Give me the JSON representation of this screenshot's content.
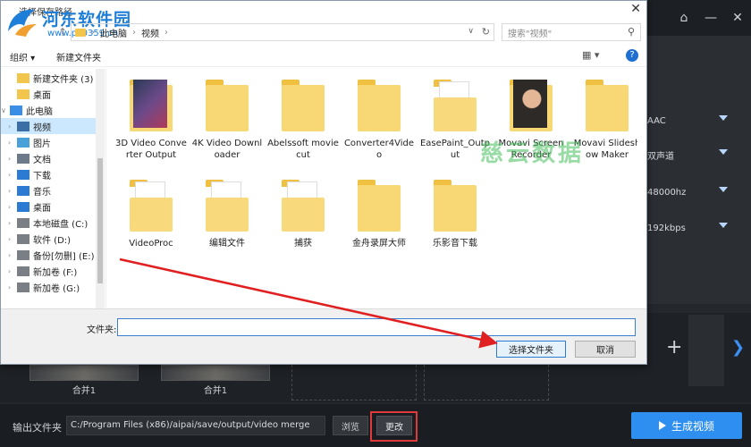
{
  "dialog": {
    "title": "选择保存路径",
    "watermark": {
      "name": "河东软件园",
      "url": "www.pc0359.cn"
    },
    "address": {
      "segments": [
        "此电脑",
        "视频"
      ],
      "search_placeholder": "搜索\"视频\""
    },
    "toolbar": {
      "organize": "组织 ▾",
      "new_folder": "新建文件夹"
    },
    "nav": [
      {
        "label": "新建文件夹 (3)",
        "icon": "folder-icon",
        "indent": 1
      },
      {
        "label": "桌面",
        "icon": "folder-icon",
        "indent": 1
      },
      {
        "label": "此电脑",
        "icon": "computer-icon",
        "indent": 0,
        "expanded": true
      },
      {
        "label": "视频",
        "icon": "video-icon",
        "indent": 1,
        "selected": true
      },
      {
        "label": "图片",
        "icon": "picture-icon",
        "indent": 1
      },
      {
        "label": "文档",
        "icon": "document-icon",
        "indent": 1
      },
      {
        "label": "下载",
        "icon": "download-icon",
        "indent": 1
      },
      {
        "label": "音乐",
        "icon": "music-icon",
        "indent": 1
      },
      {
        "label": "桌面",
        "icon": "desktop-icon",
        "indent": 1
      },
      {
        "label": "本地磁盘 (C:)",
        "icon": "disk-icon",
        "indent": 1
      },
      {
        "label": "软件 (D:)",
        "icon": "disk-icon",
        "indent": 1
      },
      {
        "label": "备份[勿删] (E:)",
        "icon": "disk-icon",
        "indent": 1
      },
      {
        "label": "新加卷 (F:)",
        "icon": "disk-icon",
        "indent": 1
      },
      {
        "label": "新加卷 (G:)",
        "icon": "disk-icon",
        "indent": 1
      }
    ],
    "files": [
      {
        "name": "3D Video Converter Output",
        "kind": "preview-dark"
      },
      {
        "name": "4K Video Downloader",
        "kind": "folder"
      },
      {
        "name": "Abelssoft moviecut",
        "kind": "folder"
      },
      {
        "name": "Converter4Video",
        "kind": "folder"
      },
      {
        "name": "EasePaint_Output",
        "kind": "paper"
      },
      {
        "name": "Movavi Screen Recorder",
        "kind": "preview-photo"
      },
      {
        "name": "Movavi Slideshow Maker",
        "kind": "folder"
      },
      {
        "name": "VideoProc",
        "kind": "paper"
      },
      {
        "name": "编辑文件",
        "kind": "paper"
      },
      {
        "name": "捕获",
        "kind": "paper"
      },
      {
        "name": "金舟录屏大师",
        "kind": "folder"
      },
      {
        "name": "乐影音下载",
        "kind": "folder"
      }
    ],
    "folder_label": "文件夹:",
    "folder_value": "",
    "buttons": {
      "select": "选择文件夹",
      "cancel": "取消"
    },
    "overlay_watermark": "慈云数据"
  },
  "app": {
    "window_buttons": [
      "⌂",
      "—",
      "✕"
    ],
    "settings": [
      "AAC",
      "双声道",
      "48000hz",
      "192kbps"
    ],
    "thumbs": [
      "合并1",
      "合并1"
    ],
    "output_label": "输出文件夹",
    "output_path": "C:/Program Files (x86)/aipai/save/output/video merge",
    "browse": "浏览",
    "change": "更改",
    "generate": "生成视频",
    "accent": "#2f8ff0"
  }
}
